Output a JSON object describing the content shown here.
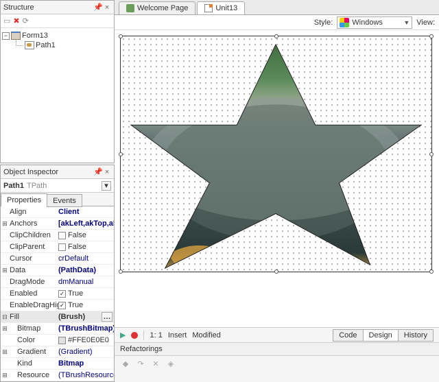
{
  "structure": {
    "title": "Structure",
    "nodes": {
      "form": "Form13",
      "path": "Path1"
    }
  },
  "inspector": {
    "title": "Object Inspector",
    "selected_name": "Path1",
    "selected_type": "TPath",
    "tabs": {
      "properties": "Properties",
      "events": "Events"
    },
    "props": {
      "align": {
        "name": "Align",
        "value": "Client"
      },
      "anchors": {
        "name": "Anchors",
        "value": "[akLeft,akTop,akRig"
      },
      "clipchildren": {
        "name": "ClipChildren",
        "value": "False"
      },
      "clipparent": {
        "name": "ClipParent",
        "value": "False"
      },
      "cursor": {
        "name": "Cursor",
        "value": "crDefault"
      },
      "data": {
        "name": "Data",
        "value": "(PathData)"
      },
      "dragmode": {
        "name": "DragMode",
        "value": "dmManual"
      },
      "enabled": {
        "name": "Enabled",
        "value": "True"
      },
      "enabledraghigh": {
        "name": "EnableDragHigh",
        "value": "True"
      },
      "fill": {
        "name": "Fill",
        "value": "(Brush)"
      },
      "bitmap": {
        "name": "Bitmap",
        "value": "(TBrushBitmap)"
      },
      "color": {
        "name": "Color",
        "value": "#FFE0E0E0"
      },
      "gradient": {
        "name": "Gradient",
        "value": "(Gradient)"
      },
      "kind": {
        "name": "Kind",
        "value": "Bitmap"
      },
      "resource": {
        "name": "Resource",
        "value": "(TBrushResource)"
      }
    }
  },
  "tabs": {
    "welcome": "Welcome Page",
    "unit": "Unit13"
  },
  "stylebar": {
    "label": "Style:",
    "value": "Windows",
    "view": "View:"
  },
  "statusbar": {
    "pos": "1:   1",
    "insert": "Insert",
    "modified": "Modified",
    "code": "Code",
    "design": "Design",
    "history": "History"
  },
  "refactorings": {
    "title": "Refactorings"
  }
}
